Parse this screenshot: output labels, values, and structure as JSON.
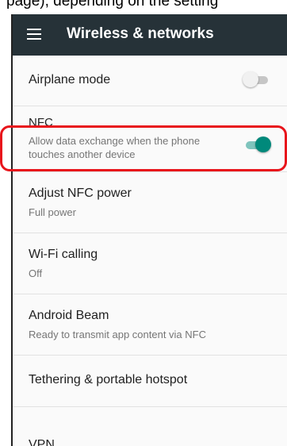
{
  "page_caption_fragment": "page), depending on the setting",
  "app_bar": {
    "menu_icon": "hamburger-menu-icon",
    "title": "Wireless & networks",
    "background": "#263238"
  },
  "settings": [
    {
      "id": "airplane",
      "title": "Airplane mode",
      "summary": "",
      "toggle": "off"
    },
    {
      "id": "nfc",
      "title": "NFC",
      "summary": "Allow data exchange when the phone touches another device",
      "toggle": "on"
    },
    {
      "id": "adjust-nfc-power",
      "title": "Adjust NFC power",
      "summary": "Full power"
    },
    {
      "id": "wifi-calling",
      "title": "Wi-Fi calling",
      "summary": "Off"
    },
    {
      "id": "android-beam",
      "title": "Android Beam",
      "summary": "Ready to transmit app content via NFC"
    },
    {
      "id": "tethering",
      "title": "Tethering & portable hotspot",
      "summary": ""
    },
    {
      "id": "vpn",
      "title": "VPN",
      "summary": ""
    }
  ],
  "colors": {
    "accent": "#00897b",
    "highlight_border": "#e8141b",
    "toggle_off_track": "#c6c6c6",
    "toggle_off_thumb": "#f1f1f1"
  }
}
